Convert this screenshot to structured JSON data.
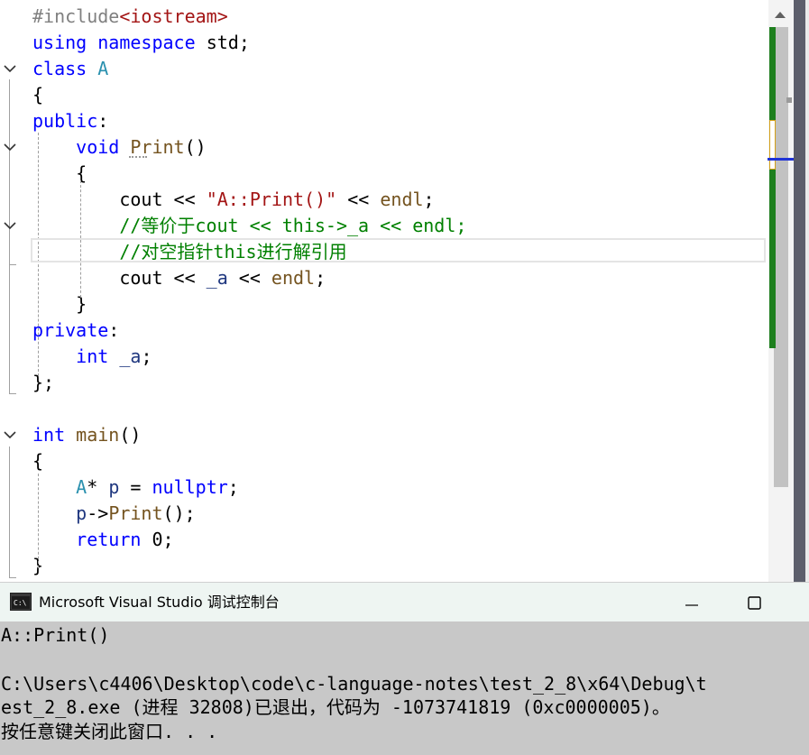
{
  "editor": {
    "lines": [
      [
        [
          "pp",
          "#include"
        ],
        [
          "inc",
          "<iostream>"
        ]
      ],
      [
        [
          "kw",
          "using"
        ],
        [
          "plain",
          " "
        ],
        [
          "kw",
          "namespace"
        ],
        [
          "plain",
          " "
        ],
        [
          "ns",
          "std"
        ],
        [
          "plain",
          ";"
        ]
      ],
      [
        [
          "kw",
          "class"
        ],
        [
          "plain",
          " "
        ],
        [
          "cls",
          "A"
        ]
      ],
      [
        [
          "plain",
          "{"
        ]
      ],
      [
        [
          "kw",
          "public"
        ],
        [
          "plain",
          ":"
        ]
      ],
      [
        [
          "plain",
          "    "
        ],
        [
          "kw",
          "void"
        ],
        [
          "plain",
          " "
        ],
        [
          "fn",
          "Print"
        ],
        [
          "plain",
          "()"
        ]
      ],
      [
        [
          "plain",
          "    {"
        ]
      ],
      [
        [
          "plain",
          "        cout "
        ],
        [
          "plain",
          "<<"
        ],
        [
          "plain",
          " "
        ],
        [
          "str",
          "\"A::Print()\""
        ],
        [
          "plain",
          " << "
        ],
        [
          "fn",
          "endl"
        ],
        [
          "plain",
          ";"
        ]
      ],
      [
        [
          "plain",
          "        "
        ],
        [
          "cm",
          "//等价于cout << this->_a << endl;"
        ]
      ],
      [
        [
          "plain",
          "        "
        ],
        [
          "cm",
          "//对空指针this进行解引用"
        ]
      ],
      [
        [
          "plain",
          "        cout << "
        ],
        [
          "var",
          "_a"
        ],
        [
          "plain",
          " << "
        ],
        [
          "fn",
          "endl"
        ],
        [
          "plain",
          ";"
        ]
      ],
      [
        [
          "plain",
          "    }"
        ]
      ],
      [
        [
          "kw",
          "private"
        ],
        [
          "plain",
          ":"
        ]
      ],
      [
        [
          "plain",
          "    "
        ],
        [
          "kw",
          "int"
        ],
        [
          "plain",
          " "
        ],
        [
          "var",
          "_a"
        ],
        [
          "plain",
          ";"
        ]
      ],
      [
        [
          "plain",
          "};"
        ]
      ],
      [
        [
          "plain",
          ""
        ]
      ],
      [
        [
          "kw",
          "int"
        ],
        [
          "plain",
          " "
        ],
        [
          "fn",
          "main"
        ],
        [
          "plain",
          "()"
        ]
      ],
      [
        [
          "plain",
          "{"
        ]
      ],
      [
        [
          "plain",
          "    "
        ],
        [
          "cls",
          "A"
        ],
        [
          "plain",
          "* "
        ],
        [
          "var",
          "p"
        ],
        [
          "plain",
          " = "
        ],
        [
          "kw",
          "nullptr"
        ],
        [
          "plain",
          ";"
        ]
      ],
      [
        [
          "plain",
          "    "
        ],
        [
          "var",
          "p"
        ],
        [
          "plain",
          "->"
        ],
        [
          "fn",
          "Print"
        ],
        [
          "plain",
          "();"
        ]
      ],
      [
        [
          "plain",
          "    "
        ],
        [
          "kw",
          "return"
        ],
        [
          "plain",
          " 0;"
        ]
      ],
      [
        [
          "plain",
          "}"
        ]
      ]
    ],
    "fold_lines": [
      2,
      5,
      8,
      16
    ]
  },
  "console": {
    "title": "Microsoft Visual Studio 调试控制台",
    "icon": "console-app-icon",
    "lines": [
      "A::Print()",
      "",
      "C:\\Users\\c4406\\Desktop\\code\\c-language-notes\\test_2_8\\x64\\Debug\\t",
      "est_2_8.exe (进程 32808)已退出，代码为 -1073741819 (0xc0000005)。",
      "按任意键关闭此窗口. . ."
    ]
  },
  "colors": {
    "keyword": "#0000ff",
    "type": "#2b91af",
    "function": "#74531f",
    "string": "#a31515",
    "comment": "#008000",
    "variable": "#1f377f",
    "change_bar": "#1e7f1e",
    "caret_marker": "#1f33d6",
    "console_bg": "#c8c8c8"
  }
}
